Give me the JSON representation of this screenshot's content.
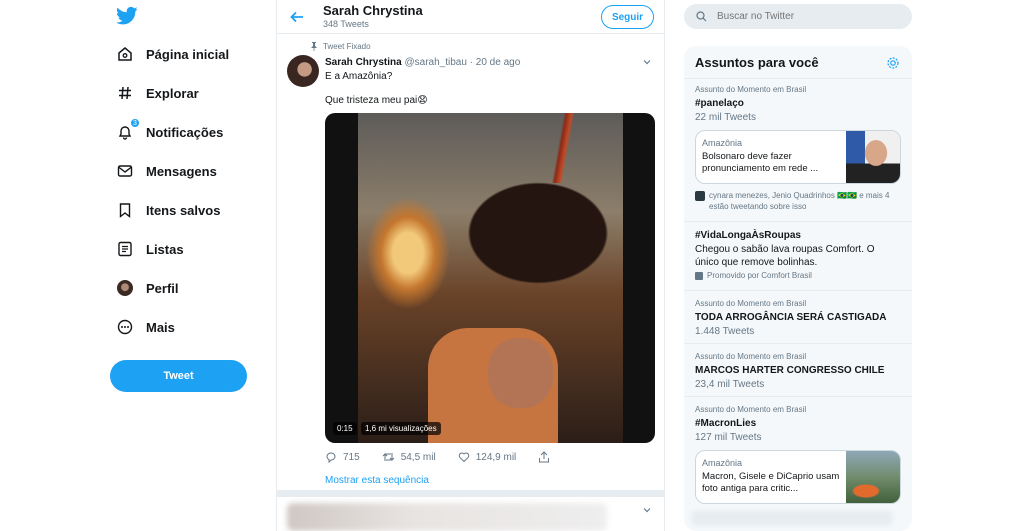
{
  "nav": {
    "items": [
      {
        "label": "Página inicial",
        "icon": "home-icon"
      },
      {
        "label": "Explorar",
        "icon": "hashtag-icon"
      },
      {
        "label": "Notificações",
        "icon": "bell-icon",
        "badge": "3"
      },
      {
        "label": "Mensagens",
        "icon": "envelope-icon"
      },
      {
        "label": "Itens salvos",
        "icon": "bookmark-icon"
      },
      {
        "label": "Listas",
        "icon": "list-icon"
      },
      {
        "label": "Perfil",
        "icon": "avatar"
      },
      {
        "label": "Mais",
        "icon": "more-icon"
      }
    ],
    "tweet_button": "Tweet"
  },
  "header": {
    "name": "Sarah Chrystina",
    "tweet_count": "348 Tweets",
    "follow_label": "Seguir"
  },
  "tweet": {
    "pinned_label": "Tweet Fixado",
    "author_name": "Sarah Chrystina",
    "handle_date": "@sarah_tibau · 20 de ago",
    "text1": "E a Amazônia?",
    "text2": "Que tristeza meu pai😧",
    "video_time": "0:15",
    "video_views": "1,6 mi visualizações",
    "replies": "715",
    "retweets": "54,5 mil",
    "likes": "124,9 mil",
    "show_thread": "Mostrar esta sequência"
  },
  "search": {
    "placeholder": "Buscar no Twitter"
  },
  "trends": {
    "title": "Assuntos para você",
    "items": [
      {
        "context": "Assunto do Momento em Brasil",
        "name": "#panelaço",
        "count": "22 mil Tweets"
      },
      {
        "name": "#VidaLongaÀsRoupas",
        "description": "Chegou o sabão lava roupas Comfort. O único que remove bolinhas.",
        "promoted": "Promovido por Comfort Brasil"
      },
      {
        "context": "Assunto do Momento em Brasil",
        "name": "TODA ARROGÂNCIA SERÁ CASTIGADA",
        "count": "1.448 Tweets"
      },
      {
        "context": "Assunto do Momento em Brasil",
        "name": "MARCOS HARTER CONGRESSO CHILE",
        "count": "23,4 mil Tweets"
      },
      {
        "context": "Assunto do Momento em Brasil",
        "name": "#MacronLies",
        "count": "127 mil Tweets"
      }
    ],
    "card1": {
      "category": "Amazônia",
      "text": "Bolsonaro deve fazer pronunciamento em rede ..."
    },
    "card1_tweeting": "cynara menezes, Jenio Quadrinhos 🇧🇷🇧🇷 e mais 4 estão tweetando sobre isso",
    "card2": {
      "category": "Amazônia",
      "text": "Macron, Gisele e DiCaprio usam foto antiga para critic..."
    }
  },
  "colors": {
    "accent": "#1da1f2",
    "text": "#14171a",
    "muted": "#657786",
    "border": "#e6ecf0"
  }
}
